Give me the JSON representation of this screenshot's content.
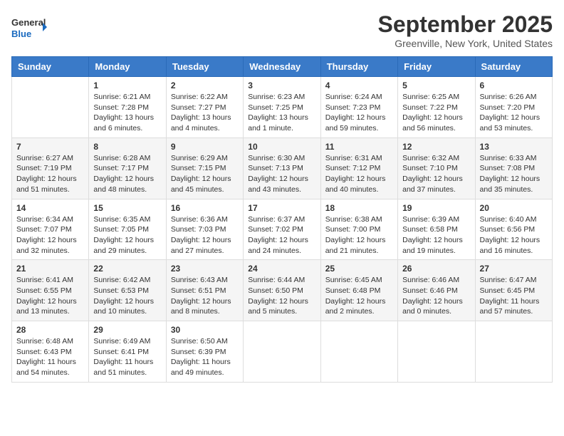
{
  "header": {
    "logo_line1": "General",
    "logo_line2": "Blue",
    "month": "September 2025",
    "location": "Greenville, New York, United States"
  },
  "days_of_week": [
    "Sunday",
    "Monday",
    "Tuesday",
    "Wednesday",
    "Thursday",
    "Friday",
    "Saturday"
  ],
  "weeks": [
    [
      {
        "day": "",
        "info": ""
      },
      {
        "day": "1",
        "info": "Sunrise: 6:21 AM\nSunset: 7:28 PM\nDaylight: 13 hours\nand 6 minutes."
      },
      {
        "day": "2",
        "info": "Sunrise: 6:22 AM\nSunset: 7:27 PM\nDaylight: 13 hours\nand 4 minutes."
      },
      {
        "day": "3",
        "info": "Sunrise: 6:23 AM\nSunset: 7:25 PM\nDaylight: 13 hours\nand 1 minute."
      },
      {
        "day": "4",
        "info": "Sunrise: 6:24 AM\nSunset: 7:23 PM\nDaylight: 12 hours\nand 59 minutes."
      },
      {
        "day": "5",
        "info": "Sunrise: 6:25 AM\nSunset: 7:22 PM\nDaylight: 12 hours\nand 56 minutes."
      },
      {
        "day": "6",
        "info": "Sunrise: 6:26 AM\nSunset: 7:20 PM\nDaylight: 12 hours\nand 53 minutes."
      }
    ],
    [
      {
        "day": "7",
        "info": "Sunrise: 6:27 AM\nSunset: 7:19 PM\nDaylight: 12 hours\nand 51 minutes."
      },
      {
        "day": "8",
        "info": "Sunrise: 6:28 AM\nSunset: 7:17 PM\nDaylight: 12 hours\nand 48 minutes."
      },
      {
        "day": "9",
        "info": "Sunrise: 6:29 AM\nSunset: 7:15 PM\nDaylight: 12 hours\nand 45 minutes."
      },
      {
        "day": "10",
        "info": "Sunrise: 6:30 AM\nSunset: 7:13 PM\nDaylight: 12 hours\nand 43 minutes."
      },
      {
        "day": "11",
        "info": "Sunrise: 6:31 AM\nSunset: 7:12 PM\nDaylight: 12 hours\nand 40 minutes."
      },
      {
        "day": "12",
        "info": "Sunrise: 6:32 AM\nSunset: 7:10 PM\nDaylight: 12 hours\nand 37 minutes."
      },
      {
        "day": "13",
        "info": "Sunrise: 6:33 AM\nSunset: 7:08 PM\nDaylight: 12 hours\nand 35 minutes."
      }
    ],
    [
      {
        "day": "14",
        "info": "Sunrise: 6:34 AM\nSunset: 7:07 PM\nDaylight: 12 hours\nand 32 minutes."
      },
      {
        "day": "15",
        "info": "Sunrise: 6:35 AM\nSunset: 7:05 PM\nDaylight: 12 hours\nand 29 minutes."
      },
      {
        "day": "16",
        "info": "Sunrise: 6:36 AM\nSunset: 7:03 PM\nDaylight: 12 hours\nand 27 minutes."
      },
      {
        "day": "17",
        "info": "Sunrise: 6:37 AM\nSunset: 7:02 PM\nDaylight: 12 hours\nand 24 minutes."
      },
      {
        "day": "18",
        "info": "Sunrise: 6:38 AM\nSunset: 7:00 PM\nDaylight: 12 hours\nand 21 minutes."
      },
      {
        "day": "19",
        "info": "Sunrise: 6:39 AM\nSunset: 6:58 PM\nDaylight: 12 hours\nand 19 minutes."
      },
      {
        "day": "20",
        "info": "Sunrise: 6:40 AM\nSunset: 6:56 PM\nDaylight: 12 hours\nand 16 minutes."
      }
    ],
    [
      {
        "day": "21",
        "info": "Sunrise: 6:41 AM\nSunset: 6:55 PM\nDaylight: 12 hours\nand 13 minutes."
      },
      {
        "day": "22",
        "info": "Sunrise: 6:42 AM\nSunset: 6:53 PM\nDaylight: 12 hours\nand 10 minutes."
      },
      {
        "day": "23",
        "info": "Sunrise: 6:43 AM\nSunset: 6:51 PM\nDaylight: 12 hours\nand 8 minutes."
      },
      {
        "day": "24",
        "info": "Sunrise: 6:44 AM\nSunset: 6:50 PM\nDaylight: 12 hours\nand 5 minutes."
      },
      {
        "day": "25",
        "info": "Sunrise: 6:45 AM\nSunset: 6:48 PM\nDaylight: 12 hours\nand 2 minutes."
      },
      {
        "day": "26",
        "info": "Sunrise: 6:46 AM\nSunset: 6:46 PM\nDaylight: 12 hours\nand 0 minutes."
      },
      {
        "day": "27",
        "info": "Sunrise: 6:47 AM\nSunset: 6:45 PM\nDaylight: 11 hours\nand 57 minutes."
      }
    ],
    [
      {
        "day": "28",
        "info": "Sunrise: 6:48 AM\nSunset: 6:43 PM\nDaylight: 11 hours\nand 54 minutes."
      },
      {
        "day": "29",
        "info": "Sunrise: 6:49 AM\nSunset: 6:41 PM\nDaylight: 11 hours\nand 51 minutes."
      },
      {
        "day": "30",
        "info": "Sunrise: 6:50 AM\nSunset: 6:39 PM\nDaylight: 11 hours\nand 49 minutes."
      },
      {
        "day": "",
        "info": ""
      },
      {
        "day": "",
        "info": ""
      },
      {
        "day": "",
        "info": ""
      },
      {
        "day": "",
        "info": ""
      }
    ]
  ]
}
